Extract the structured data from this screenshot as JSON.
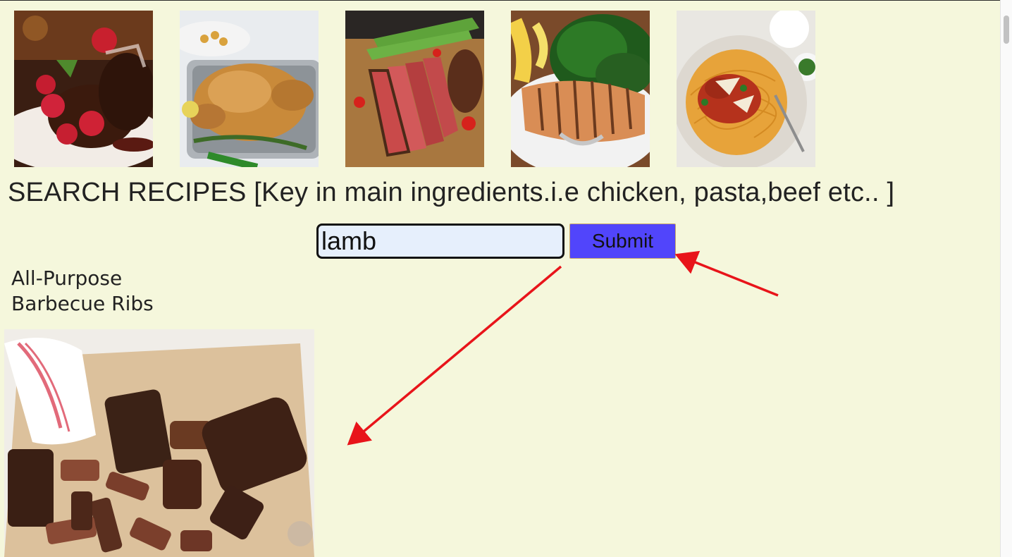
{
  "gallery": [
    {
      "name": "chocolate-lava-cake-image"
    },
    {
      "name": "roast-chicken-image"
    },
    {
      "name": "sliced-steak-image"
    },
    {
      "name": "grilled-salmon-image"
    },
    {
      "name": "spaghetti-bolognese-image"
    }
  ],
  "search": {
    "heading": "SEARCH RECIPES [Key in main ingredients.i.e chicken, pasta,beef etc.. ]",
    "value": "lamb",
    "submit_label": "Submit"
  },
  "result": {
    "title": "All-Purpose Barbecue Ribs"
  },
  "colors": {
    "page_background": "#f5f7dc",
    "submit_button": "#5145fb",
    "annotation_arrow": "#e8141a"
  }
}
